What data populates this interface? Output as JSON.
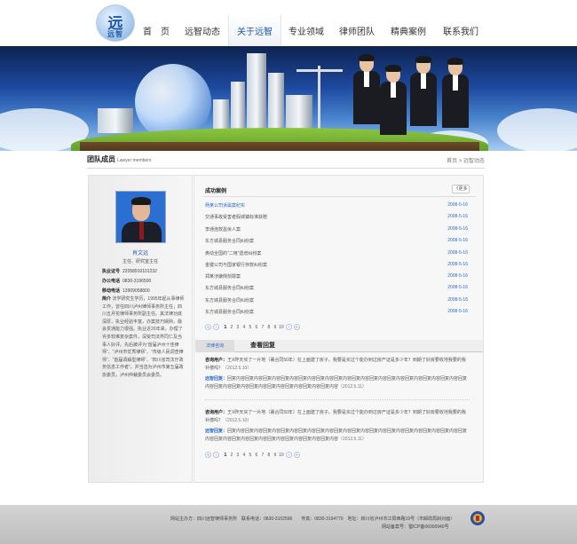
{
  "logo": {
    "mark": "远",
    "text": "远智"
  },
  "nav": [
    {
      "label": "首　页",
      "active": false
    },
    {
      "label": "远智动态",
      "active": false
    },
    {
      "label": "关于远智",
      "active": true
    },
    {
      "label": "专业领域",
      "active": false
    },
    {
      "label": "律师团队",
      "active": false
    },
    {
      "label": "精典案例",
      "active": false
    },
    {
      "label": "联系我们",
      "active": false
    }
  ],
  "section": {
    "title": "团队成员",
    "title_en": "Lawyer members",
    "breadcrumb": "首页 > 远智动态"
  },
  "profile": {
    "name": "肖文远",
    "title": "主任、研究室主任",
    "fields": [
      {
        "label": "执业证号",
        "value": "22058910101232"
      },
      {
        "label": "办公电话",
        "value": "0830-3196500"
      },
      {
        "label": "移动电话",
        "value": "13909058800"
      }
    ],
    "bio_label": "简介",
    "bio": "法学研究生学历，1995年起从事律师工作，曾任四川泸州律师事务所主任；四川五月花律师事务所副主任。其法律功底深厚，执业经验丰富，办案技巧娴熟，融会贯通能力很强。执业近20年来，办理了许多较难复杂案件，深受司法界同仁及当事人好评。先后被评为“首届泸州十佳律师”、“泸州市优秀律师”、“市级人民调查律师”、“首届调解型律师”、“四川省司法厅政务信息工作者”，并当选为泸州市第五届政协委员，泸州仲裁委员会委员。"
  },
  "cases": {
    "heading": "成功案例",
    "more": "《更多",
    "items": [
      {
        "title": "杨某公司诉属案纪实",
        "date": "2008-5-16"
      },
      {
        "title": "交通事故受害者假城镇标准获赔",
        "date": "2008-5-16"
      },
      {
        "title": "李通连款盈余人案",
        "date": "2008-5-16"
      },
      {
        "title": "东方城县服务合同纠纷案",
        "date": "2008-5-16"
      },
      {
        "title": "奥动全国的“二用”遗增纠纷案",
        "date": "2008-5-16"
      },
      {
        "title": "金键公司与国家银行存款纠纷案",
        "date": "2008-5-16"
      },
      {
        "title": "郑某涉嫌侧刻罪案",
        "date": "2008-5-16"
      },
      {
        "title": "东方城县服务合同纠纷案",
        "date": "2008-5-16"
      },
      {
        "title": "东方城县服务合同纠纷案",
        "date": "2008-5-16"
      },
      {
        "title": "东方城县服务合同纠纷案",
        "date": "2008-5-16"
      }
    ]
  },
  "pager": {
    "prev": [
      "«",
      "‹"
    ],
    "pages": [
      "1",
      "2",
      "3",
      "4",
      "5",
      "6",
      "7",
      "8",
      "9",
      "10"
    ],
    "next": [
      "›",
      "»"
    ]
  },
  "tabs": {
    "tab1": "法律咨询",
    "tab2": "查看回复"
  },
  "messages": [
    {
      "q_label": "咨询用户：",
      "q_text": "王X昨天买了一片地（署合同50年）在上面建了房子。我要是买过个能办到过房产证是多少年？到期了好房要收地我要的我补偿吗？",
      "q_date": "（2012.5.10）",
      "a_label": "远智回复：",
      "a_text": "回复内容回复内容回复内容回复内容回复内容回复内容回复内容回复内容回复内容回复内容回复内容回复内容回复内容回复内容回复内容回复内容回复内容回复内容回复内容回复内容回复内容",
      "a_date": "（2012.5.11）"
    },
    {
      "q_label": "咨询用户：",
      "q_text": "王X昨天买了一片地（署合同50年）在上面建了房子。我要是买过个能办到过房产证是多少年？到期了好房要收地我要的我补偿吗？",
      "q_date": "（2012.5.10）",
      "a_label": "远智回复：",
      "a_text": "回复内容回复内容回复内容回复内容回复内容回复内容回复内容回复内容回复内容回复内容回复内容回复内容回复内容回复内容回复内容回复内容回复内容回复内容回复内容回复内容回复内容",
      "a_date": "（2012.5.11）"
    }
  ],
  "footer": {
    "line1": "网站主办方：四川远智律师事务所　联系电话：0830-3102596　　传真：0830-3194770　地址：四川省泸州市江阳西路19号（市邮政局斜对面）",
    "line2": "网站备案号：蜀ICP备06006940号"
  },
  "colors": {
    "accent": "#2a6bc9",
    "footer": "#c6c6c6"
  }
}
